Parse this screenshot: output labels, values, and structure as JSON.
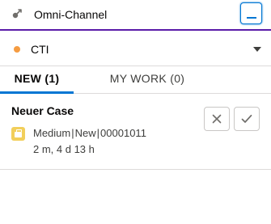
{
  "header": {
    "title": "Omni-Channel",
    "logo_icon": "omni-channel-icon",
    "minimize_icon": "minimize-icon"
  },
  "status": {
    "label": "CTI",
    "color": "#f59c42",
    "chevron_icon": "chevron-down-icon"
  },
  "tabs": [
    {
      "label": "NEW (1)",
      "selected": true
    },
    {
      "label": "MY WORK (0)",
      "selected": false
    }
  ],
  "work_items": [
    {
      "title": "Neuer Case",
      "icon": "case-icon",
      "priority": "Medium",
      "status": "New",
      "case_number": "00001011",
      "separator": "|",
      "elapsed": "2 m, 4 d 13 h",
      "decline_icon": "close-icon",
      "accept_icon": "check-icon"
    }
  ],
  "colors": {
    "accent": "#0176d3",
    "header_border": "#5a1ba9",
    "case_icon": "#f2cf5b"
  }
}
